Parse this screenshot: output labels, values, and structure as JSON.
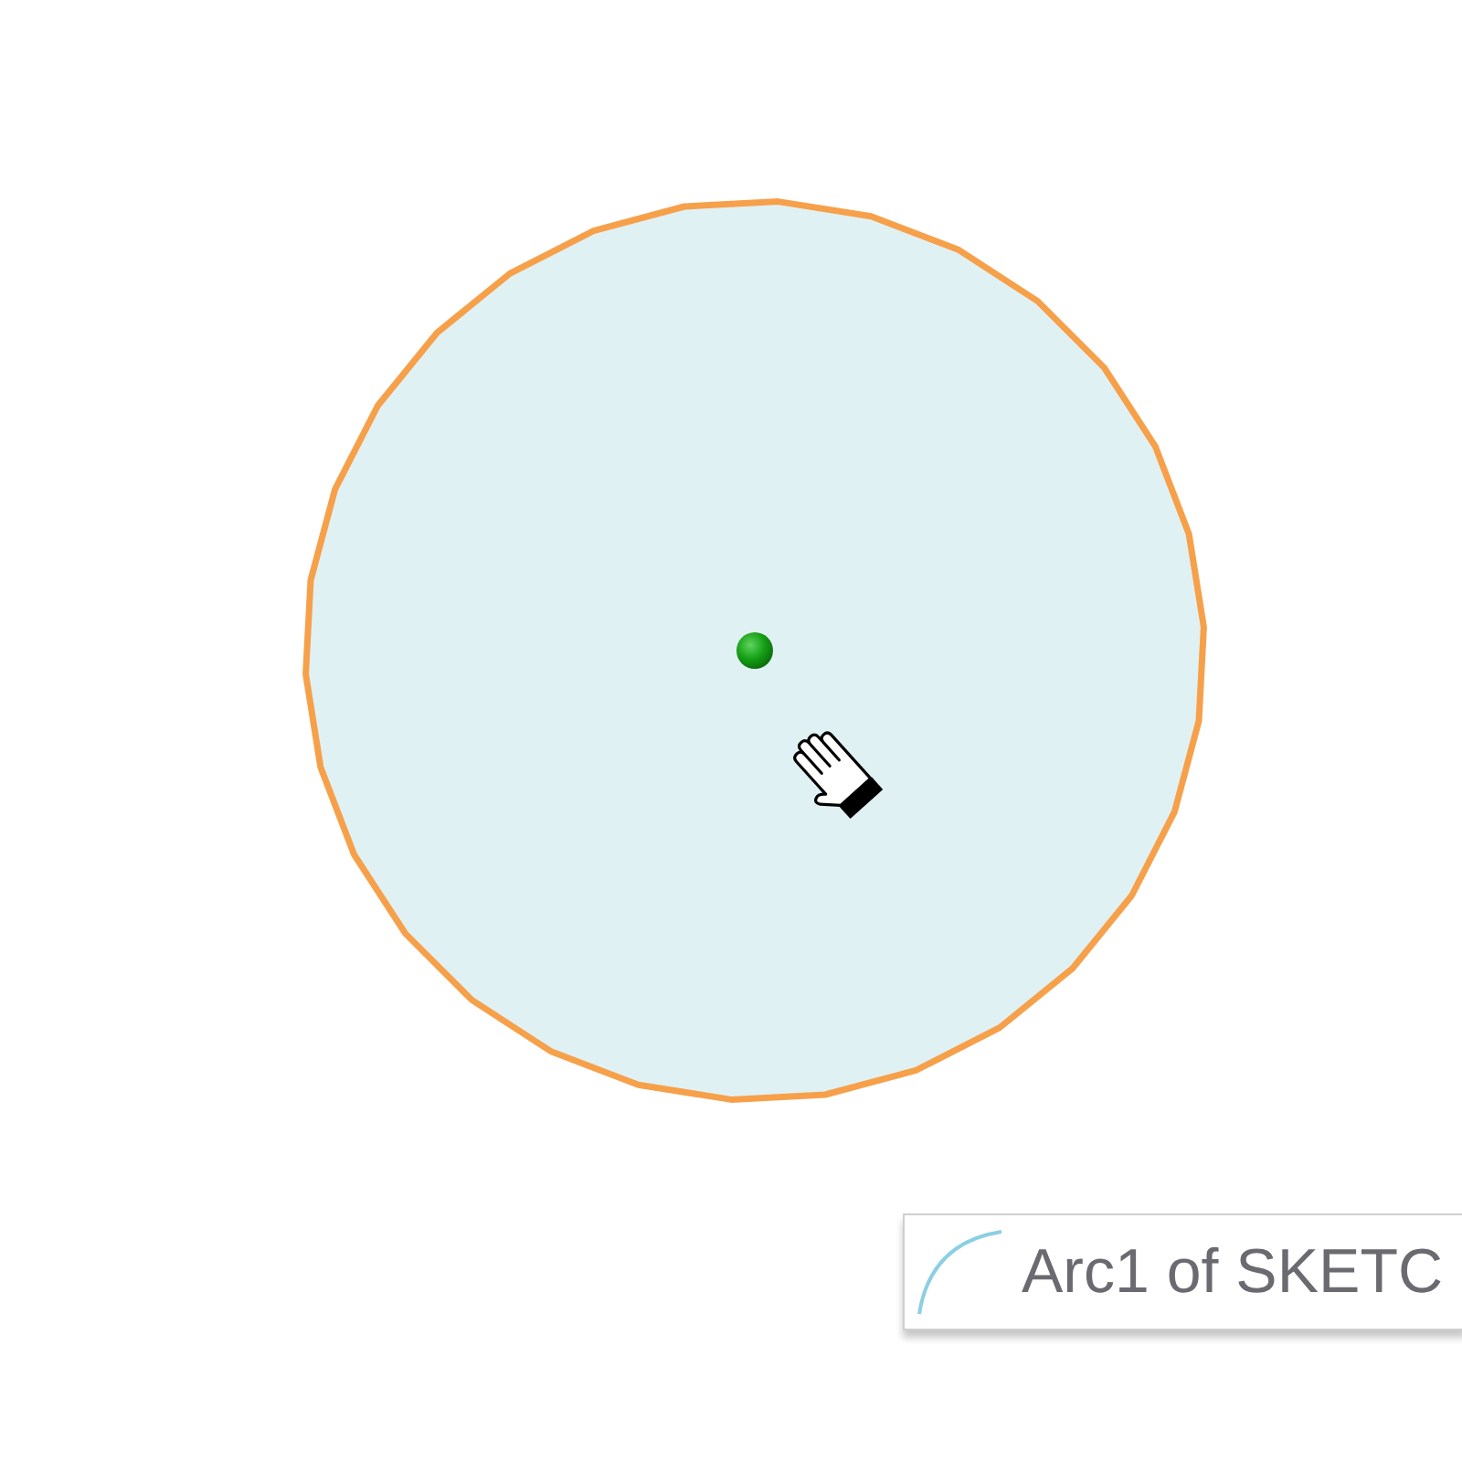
{
  "viewport": {
    "circle": {
      "highlighted": true
    },
    "tooltip": {
      "text": "Arc1 of SKETC"
    }
  }
}
